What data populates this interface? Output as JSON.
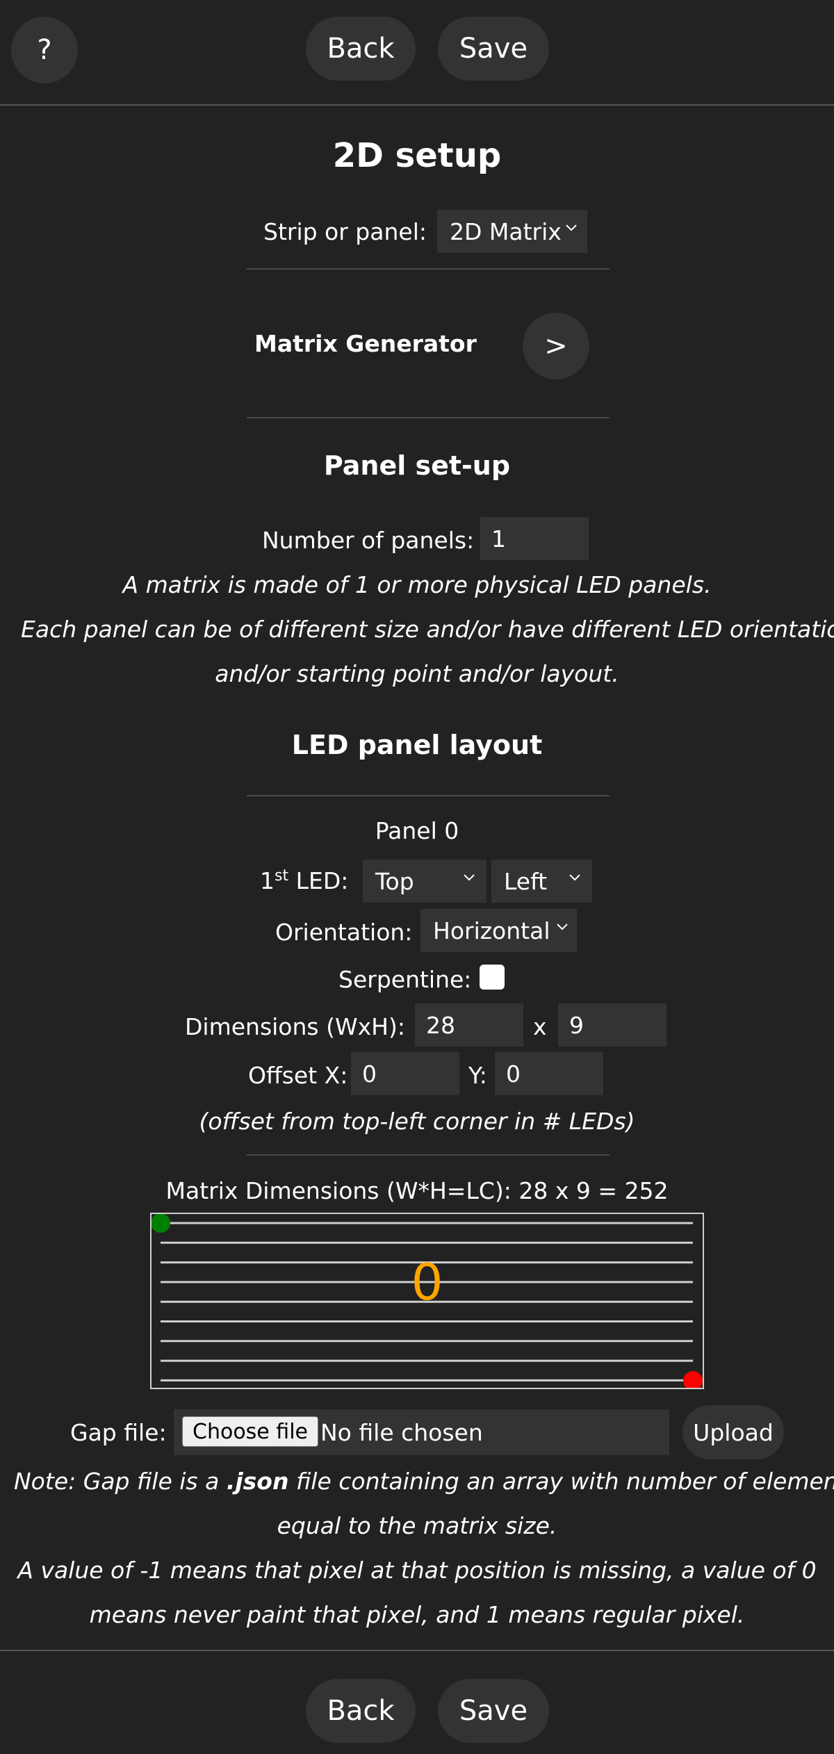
{
  "top_nav": {
    "help": "?",
    "back": "Back",
    "save": "Save"
  },
  "page_title": "2D setup",
  "strip_or_panel": {
    "label": "Strip or panel:",
    "value": "2D Matrix"
  },
  "matrix_generator": {
    "label": "Matrix Generator",
    "button": ">"
  },
  "panel_setup": {
    "heading": "Panel set-up",
    "num_panels_label": "Number of panels:",
    "num_panels_value": "1",
    "desc1": "A matrix is made of 1 or more physical LED panels.",
    "desc2": "Each panel can be of different size and/or have different LED orientation",
    "desc3": "and/or starting point and/or layout."
  },
  "layout": {
    "heading": "LED panel layout",
    "panel_name": "Panel 0",
    "first_led_label": "LED:",
    "first_led_num": "1",
    "first_led_sup": "st",
    "first_led_vertical": "Top",
    "first_led_horizontal": "Left",
    "orientation_label": "Orientation:",
    "orientation_value": "Horizontal",
    "serpentine_label": "Serpentine:",
    "serpentine_checked": false,
    "dimensions_label": "Dimensions (WxH):",
    "width": "28",
    "x_sep": "x",
    "height": "9",
    "offset_x_label": "Offset X:",
    "offset_x": "0",
    "offset_y_label": "Y:",
    "offset_y": "0",
    "offset_note": "(offset from top-left corner in # LEDs)"
  },
  "matrix": {
    "dimensions_text": "Matrix Dimensions (W*H=LC): 28 x 9 = 252",
    "panel_number": "0",
    "rows": 9,
    "start_color": "#008000",
    "end_color": "#ff0000",
    "number_color": "#ffa500"
  },
  "gap_file": {
    "label": "Gap file:",
    "choose_button": "Choose file",
    "status": "No file chosen",
    "upload": "Upload",
    "note_pre": "Note: Gap file is a ",
    "note_bold": ".json",
    "note_post": " file containing an array with number of elements",
    "note2": "equal to the matrix size.",
    "note3": "A value of -1 means that pixel at that position is missing, a value of 0",
    "note4": "means never paint that pixel, and 1 means regular pixel."
  },
  "bottom_nav": {
    "back": "Back",
    "save": "Save"
  }
}
